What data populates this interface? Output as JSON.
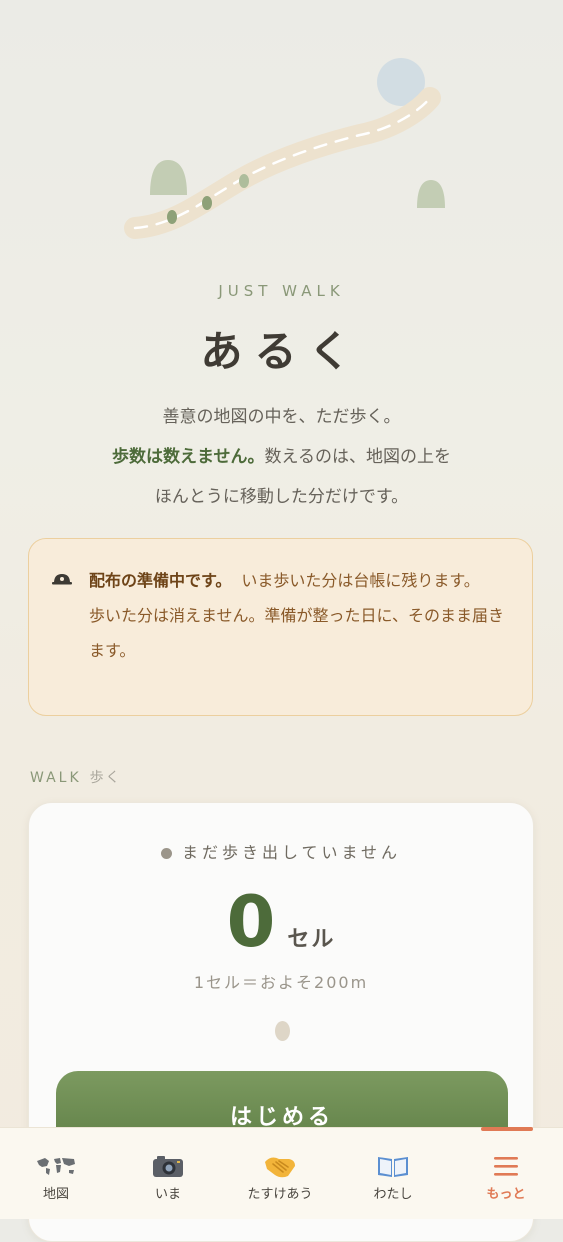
{
  "hero": {
    "eyebrow": "JUST WALK",
    "title": "あるく",
    "line1": "善意の地図の中を、ただ歩く。",
    "line2_strong": "歩数は数えません。",
    "line2_rest": "数えるのは、地図の上を",
    "line3": "ほんとうに移動した分だけです。"
  },
  "notice": {
    "icon": "hourglass-icon",
    "strong": "配布の準備中です。",
    "text1": "いま歩いた分は台帳に残ります。",
    "text2": "歩いた分は消えません。準備が整った日に、そのまま届きます。"
  },
  "section": {
    "label": "WALK",
    "label_jp": "歩く"
  },
  "walk": {
    "status": "まだ歩き出していません",
    "count": "0",
    "unit": "セル",
    "note": "1セル＝およそ200m",
    "start_label": "はじめる"
  },
  "tabs": [
    {
      "label": "地図",
      "icon": "world-map-icon"
    },
    {
      "label": "いま",
      "icon": "camera-icon"
    },
    {
      "label": "たすけあう",
      "icon": "handshake-icon"
    },
    {
      "label": "わたし",
      "icon": "book-icon"
    },
    {
      "label": "もっと",
      "icon": "menu-icon",
      "active": true
    }
  ],
  "colors": {
    "accent": "#4d6b3a",
    "active_tab": "#e07a55",
    "notice_bg": "#f8ecda"
  }
}
